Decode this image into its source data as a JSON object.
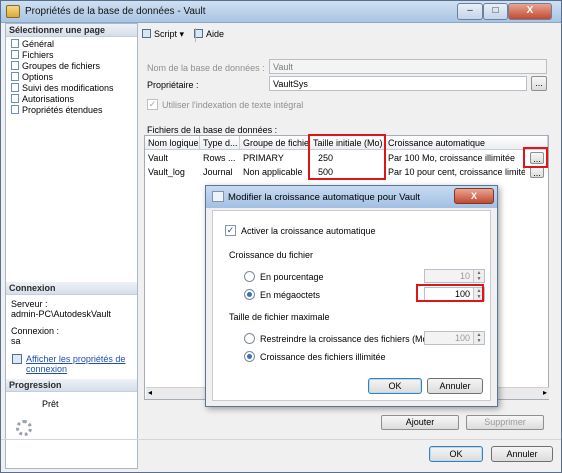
{
  "window": {
    "title": "Propriétés de la base de données - Vault",
    "min": "–",
    "max": "□",
    "close": "X"
  },
  "left": {
    "select_page_header": "Sélectionner une page",
    "pages": [
      {
        "label": "Général"
      },
      {
        "label": "Fichiers"
      },
      {
        "label": "Groupes de fichiers"
      },
      {
        "label": "Options"
      },
      {
        "label": "Suivi des modifications"
      },
      {
        "label": "Autorisations"
      },
      {
        "label": "Propriétés étendues"
      }
    ],
    "connection_header": "Connexion",
    "server_label": "Serveur :",
    "server_value": "admin-PC\\AutodeskVault",
    "connection_label": "Connexion :",
    "connection_value": "sa",
    "view_props_link_1": "Afficher les propriétés de",
    "view_props_link_2": "connexion",
    "progress_header": "Progression",
    "progress_status": "Prêt"
  },
  "toolbar": {
    "script_label": "Script",
    "script_arrow": "▾",
    "help_label": "Aide"
  },
  "form": {
    "db_name_label": "Nom de la base de données :",
    "db_name_value": "Vault",
    "owner_label": "Propriétaire :",
    "owner_value": "VaultSys",
    "owner_browse": "...",
    "fulltext_label": "Utiliser l'indexation de texte intégral",
    "fulltext_checked": true,
    "files_label": "Fichiers de la base de données :"
  },
  "grid": {
    "columns": [
      "Nom logique",
      "Type d...",
      "Groupe de fichiers",
      "Taille initiale (Mo)",
      "Croissance automatique"
    ],
    "rows": [
      {
        "name": "Vault",
        "type": "Rows ...",
        "group": "PRIMARY",
        "size": "250",
        "growth": "Par 100 Mo, croissance illimitée",
        "button": "..."
      },
      {
        "name": "Vault_log",
        "type": "Journal",
        "group": "Non applicable",
        "size": "500",
        "growth": "Par 10 pour cent, croissance limitée ...",
        "button": "..."
      }
    ],
    "scroll_left": "◂",
    "scroll_right": "▸"
  },
  "buttons": {
    "add": "Ajouter",
    "remove": "Supprimer",
    "ok": "OK",
    "cancel": "Annuler"
  },
  "modal": {
    "title": "Modifier la croissance automatique pour Vault",
    "close": "X",
    "enable_label": "Activer la croissance automatique",
    "enable_checked": true,
    "file_growth_label": "Croissance du fichier",
    "percent_label": "En pourcentage",
    "percent_value": "10",
    "percent_selected": false,
    "mb_label": "En mégaoctets",
    "mb_value": "100",
    "mb_selected": true,
    "max_size_label": "Taille de fichier maximale",
    "restrict_label": "Restreindre la croissance des fichiers (Mo)",
    "restrict_value": "100",
    "restrict_selected": false,
    "unlimited_label": "Croissance des fichiers illimitée",
    "unlimited_selected": true,
    "ok": "OK",
    "cancel": "Annuler"
  },
  "colors": {
    "highlight_red": "#e01515",
    "link_blue": "#1c4fb0",
    "titlebar": "#a9c4e3"
  },
  "icons": [
    "window-icon",
    "page-icon",
    "script-icon",
    "help-icon",
    "connection-icon",
    "progress-spinner-icon",
    "dialog-icon",
    "spin-arrows-icon"
  ]
}
